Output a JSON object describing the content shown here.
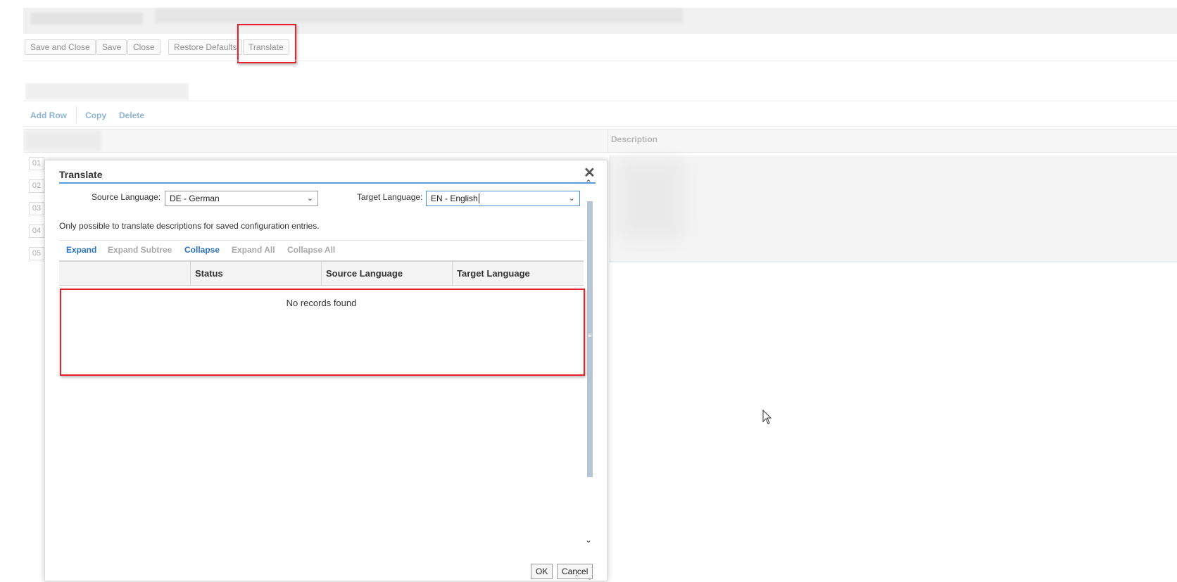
{
  "toolbar": {
    "save_close": "Save and Close",
    "save": "Save",
    "close": "Close",
    "restore_defaults": "Restore Defaults",
    "translate": "Translate"
  },
  "grid_actions": {
    "add_row": "Add Row",
    "copy": "Copy",
    "delete": "Delete"
  },
  "grid": {
    "description_header": "Description",
    "rows": [
      "01",
      "02",
      "03",
      "04",
      "05"
    ]
  },
  "dialog": {
    "title": "Translate",
    "source_label": "Source Language:",
    "source_value": "DE - German",
    "target_label": "Target Language:",
    "target_value": "EN - English",
    "note": "Only possible to translate descriptions for saved configuration entries.",
    "actions": {
      "expand": "Expand",
      "expand_subtree": "Expand Subtree",
      "collapse": "Collapse",
      "expand_all": "Expand All",
      "collapse_all": "Collapse All"
    },
    "columns": {
      "status": "Status",
      "source_language": "Source Language",
      "target_language": "Target Language"
    },
    "empty_message": "No records found",
    "ok": "OK",
    "cancel": "Cancel"
  },
  "colors": {
    "highlight": "#e8202a",
    "link_active": "#2c73c5",
    "title_underline": "#5b9bd5"
  }
}
